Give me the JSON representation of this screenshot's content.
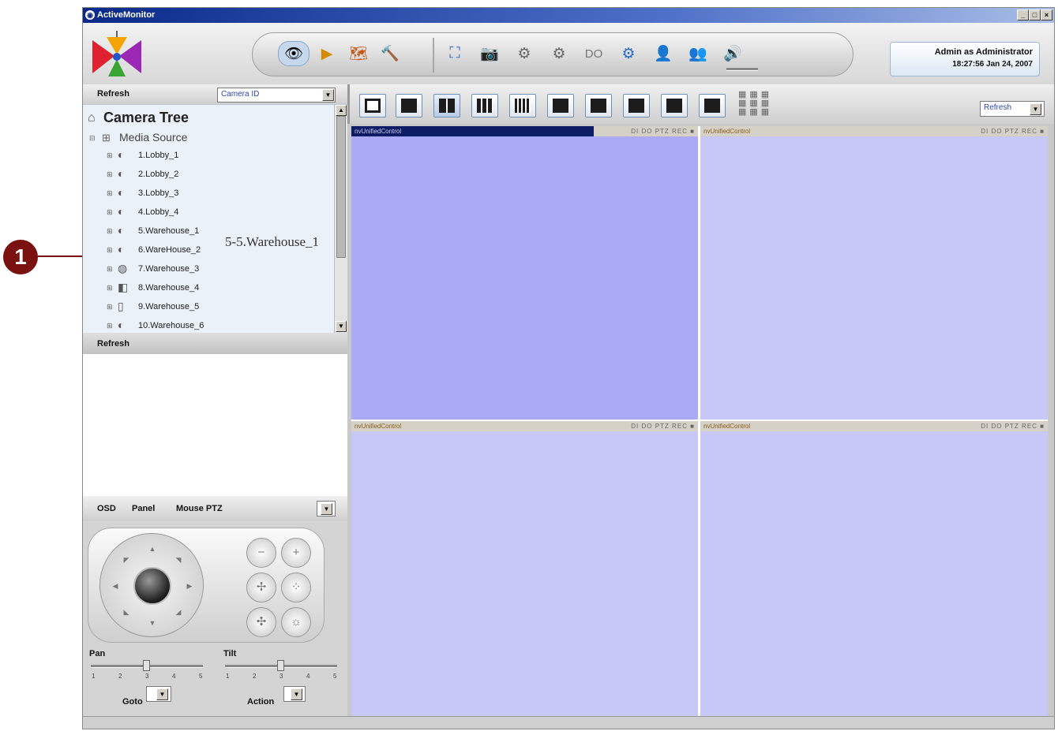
{
  "window": {
    "title": "ActiveMonitor",
    "controls": [
      "_",
      "□",
      "×"
    ]
  },
  "header": {
    "user": "Admin as Administrator",
    "datetime": "18:27:56 Jan 24, 2007",
    "tools": [
      {
        "name": "live-view",
        "glyph": "👁"
      },
      {
        "name": "playback",
        "glyph": "▶"
      },
      {
        "name": "map",
        "glyph": "🗺"
      },
      {
        "name": "setup-tools",
        "glyph": "🔨"
      },
      {
        "name": "fullscreen",
        "glyph": "⛶"
      },
      {
        "name": "snapshot",
        "glyph": "📷"
      },
      {
        "name": "settings",
        "glyph": "⚙"
      },
      {
        "name": "multi-settings",
        "glyph": "⚙"
      },
      {
        "name": "digital-output",
        "glyph": "DO"
      },
      {
        "name": "config",
        "glyph": "⚙"
      },
      {
        "name": "user",
        "glyph": "👤"
      },
      {
        "name": "users",
        "glyph": "👥"
      },
      {
        "name": "audio",
        "glyph": "🔊"
      }
    ]
  },
  "left": {
    "refresh_top": "Refresh",
    "camera_combo": "Camera ID",
    "tree_title": "Camera Tree",
    "media_source": "Media Source",
    "cameras": [
      "1.Lobby_1",
      "2.Lobby_2",
      "3.Lobby_3",
      "4.Lobby_4",
      "5.Warehouse_1",
      "6.WareHouse_2",
      "7.Warehouse_3",
      "8.Warehouse_4",
      "9.Warehouse_5",
      "10.Warehouse_6"
    ],
    "tooltip": "5-5.Warehouse_1",
    "refresh_bottom": "Refresh"
  },
  "ptz": {
    "tab_osd": "OSD",
    "tab_panel": "Panel",
    "tab_mouse": "Mouse PTZ",
    "pan_label": "Pan",
    "tilt_label": "Tilt",
    "ticks": [
      "1",
      "2",
      "3",
      "4",
      "5"
    ],
    "goto_label": "Goto",
    "action_label": "Action"
  },
  "right": {
    "refresh_combo": "Refresh",
    "panes": [
      {
        "title": "nvUnifiedControl",
        "controls": "DI DO PTZ REC ■",
        "selected": true
      },
      {
        "title": "nvUnifiedControl",
        "controls": "DI DO PTZ REC ■",
        "selected": false
      },
      {
        "title": "nvUnifiedControl",
        "controls": "DI DO PTZ REC ■",
        "selected": false
      },
      {
        "title": "nvUnifiedControl",
        "controls": "DI DO PTZ REC ■",
        "selected": false
      }
    ]
  },
  "callout": {
    "number": "1"
  },
  "colors": {
    "pane_bg": "#c8c8f8",
    "pane_selected_bg": "#aaaaf6",
    "callout": "#7a1010",
    "titlebar": "#0a2a8a"
  }
}
